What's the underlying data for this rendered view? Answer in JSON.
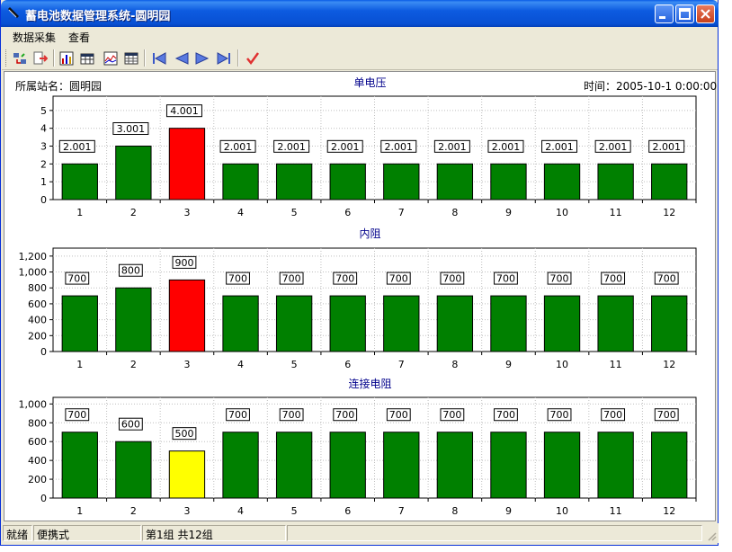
{
  "window": {
    "title": "蓄电池数据管理系统-圆明园"
  },
  "menu": {
    "items": [
      "数据采集",
      "查看"
    ]
  },
  "header": {
    "station": "所属站名：圆明园",
    "time": "时间：2005-10-1 0:00:00"
  },
  "colors": {
    "normal": "#008000",
    "high": "#ff0000",
    "low": "#ffff00",
    "axis": "#000000",
    "grid": "#bfbfbf",
    "title": "#00008b"
  },
  "chart_data": [
    {
      "type": "bar",
      "title": "单电压",
      "categories": [
        "1",
        "2",
        "3",
        "4",
        "5",
        "6",
        "7",
        "8",
        "9",
        "10",
        "11",
        "12"
      ],
      "values": [
        2.001,
        3.001,
        4.001,
        2.001,
        2.001,
        2.001,
        2.001,
        2.001,
        2.001,
        2.001,
        2.001,
        2.001
      ],
      "labels": [
        "2.001",
        "3.001",
        "4.001",
        "2.001",
        "2.001",
        "2.001",
        "2.001",
        "2.001",
        "2.001",
        "2.001",
        "2.001",
        "2.001"
      ],
      "bar_colors": [
        "#008000",
        "#008000",
        "#ff0000",
        "#008000",
        "#008000",
        "#008000",
        "#008000",
        "#008000",
        "#008000",
        "#008000",
        "#008000",
        "#008000"
      ],
      "yticks": [
        "0",
        "1",
        "2",
        "3",
        "4",
        "5"
      ],
      "ylim": [
        0,
        5.8
      ],
      "grid": true
    },
    {
      "type": "bar",
      "title": "内阻",
      "categories": [
        "1",
        "2",
        "3",
        "4",
        "5",
        "6",
        "7",
        "8",
        "9",
        "10",
        "11",
        "12"
      ],
      "values": [
        700,
        800,
        900,
        700,
        700,
        700,
        700,
        700,
        700,
        700,
        700,
        700
      ],
      "labels": [
        "700",
        "800",
        "900",
        "700",
        "700",
        "700",
        "700",
        "700",
        "700",
        "700",
        "700",
        "700"
      ],
      "bar_colors": [
        "#008000",
        "#008000",
        "#ff0000",
        "#008000",
        "#008000",
        "#008000",
        "#008000",
        "#008000",
        "#008000",
        "#008000",
        "#008000",
        "#008000"
      ],
      "yticks": [
        "0",
        "200",
        "400",
        "600",
        "800",
        "1,000",
        "1,200"
      ],
      "ylim": [
        0,
        1300
      ],
      "grid": true
    },
    {
      "type": "bar",
      "title": "连接电阻",
      "categories": [
        "1",
        "2",
        "3",
        "4",
        "5",
        "6",
        "7",
        "8",
        "9",
        "10",
        "11",
        "12"
      ],
      "values": [
        700,
        600,
        500,
        700,
        700,
        700,
        700,
        700,
        700,
        700,
        700,
        700
      ],
      "labels": [
        "700",
        "600",
        "500",
        "700",
        "700",
        "700",
        "700",
        "700",
        "700",
        "700",
        "700",
        "700"
      ],
      "bar_colors": [
        "#008000",
        "#008000",
        "#ffff00",
        "#008000",
        "#008000",
        "#008000",
        "#008000",
        "#008000",
        "#008000",
        "#008000",
        "#008000",
        "#008000"
      ],
      "yticks": [
        "0",
        "200",
        "400",
        "600",
        "800",
        "1,000"
      ],
      "ylim": [
        0,
        1070
      ],
      "grid": true
    }
  ],
  "status": {
    "ready": "就绪",
    "mode": "便携式",
    "group": "第1组 共12组"
  },
  "icons": [
    "collect-icon",
    "export-icon",
    "chart-icon",
    "table-icon",
    "curve-icon",
    "grid-icon",
    "first-icon",
    "prev-icon",
    "next-icon",
    "last-icon",
    "check-icon"
  ]
}
